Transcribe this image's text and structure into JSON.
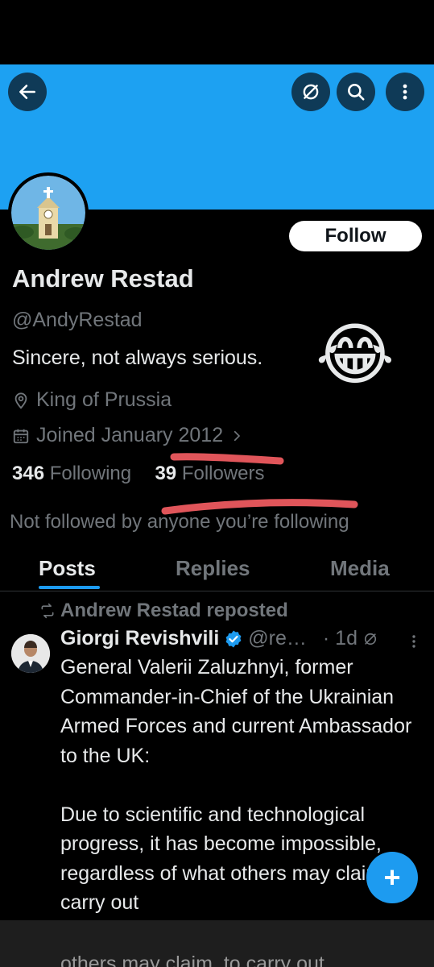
{
  "header": {
    "back_icon": "arrow-left-icon",
    "grok_icon": "slash-circle-icon",
    "search_icon": "search-icon",
    "more_icon": "more-vertical-icon",
    "banner_color": "#1da1f2"
  },
  "profile": {
    "follow_label": "Follow",
    "name": "Andrew Restad",
    "handle": "@AndyRestad",
    "bio": "Sincere, not always serious.",
    "emoji": "😂",
    "location": "King of Prussia",
    "joined": "Joined January 2012",
    "following_count": "346",
    "following_label": "Following",
    "followers_count": "39",
    "followers_label": "Followers",
    "not_followed": "Not followed by anyone you’re following"
  },
  "tabs": [
    {
      "label": "Posts",
      "active": true
    },
    {
      "label": "Replies",
      "active": false
    },
    {
      "label": "Media",
      "active": false
    }
  ],
  "post": {
    "repost_label": "Andrew Restad reposted",
    "author": "Giorgi Revishvili",
    "handle": "@re…",
    "time": "· 1d",
    "text": "General Valerii Zaluzhnyi, former Commander-in-Chief of the Ukrainian Armed Forces and current Ambassador to the UK:\n\nDue to scientific and technological progress, it has become impossible, regardless of what others may claim, to carry out",
    "bottom_text_fragment": "others may claim, to carry out"
  },
  "fab_label": "+",
  "colors": {
    "accent": "#1d9bf0",
    "annotation_red": "#e0555a",
    "muted": "#71767b"
  }
}
